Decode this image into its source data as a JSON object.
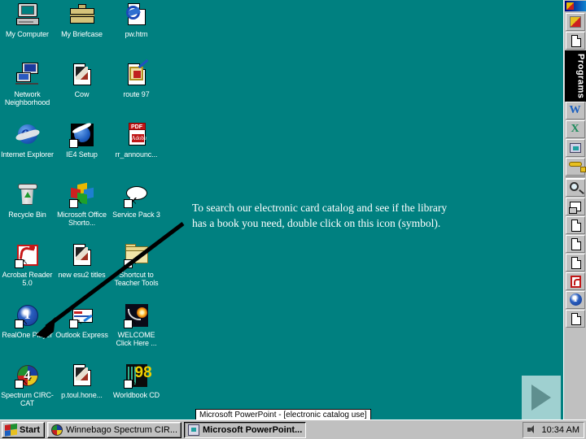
{
  "desktop": {
    "background_color": "#008080",
    "icons": [
      {
        "label": "My Computer",
        "icon": "my-computer-icon",
        "shortcut": false
      },
      {
        "label": "My Briefcase",
        "icon": "briefcase-icon",
        "shortcut": false
      },
      {
        "label": "pw.htm",
        "icon": "html-document-icon",
        "shortcut": false
      },
      {
        "label": "Network Neighborhood",
        "icon": "network-neighborhood-icon",
        "shortcut": false
      },
      {
        "label": "Cow",
        "icon": "image-document-icon",
        "shortcut": false
      },
      {
        "label": "route 97",
        "icon": "route-document-icon",
        "shortcut": false
      },
      {
        "label": "Internet Explorer",
        "icon": "internet-explorer-icon",
        "shortcut": false
      },
      {
        "label": "IE4 Setup",
        "icon": "ie4-setup-icon",
        "shortcut": true
      },
      {
        "label": "rr_announc...",
        "icon": "adobe-pdf-icon",
        "shortcut": false
      },
      {
        "label": "Recycle Bin",
        "icon": "recycle-bin-icon",
        "shortcut": false
      },
      {
        "label": "Microsoft Office Shorto...",
        "icon": "microsoft-office-icon",
        "shortcut": true
      },
      {
        "label": "Service Pack 3",
        "icon": "service-pack-icon",
        "shortcut": true
      },
      {
        "label": "Acrobat Reader 5.0",
        "icon": "acrobat-reader-icon",
        "shortcut": true
      },
      {
        "label": "new esu2 titles",
        "icon": "image-document-icon",
        "shortcut": false
      },
      {
        "label": "Shortcut to Teacher Tools",
        "icon": "folder-icon",
        "shortcut": true
      },
      {
        "label": "RealOne Player",
        "icon": "realone-player-icon",
        "shortcut": true
      },
      {
        "label": "Outlook Express",
        "icon": "outlook-express-icon",
        "shortcut": true
      },
      {
        "label": "WELCOME Click Here ...",
        "icon": "welcome-icon",
        "shortcut": true
      },
      {
        "label": "Spectrum CIRC-CAT",
        "icon": "spectrum-circ-cat-icon",
        "shortcut": true
      },
      {
        "label": "p.toul.hone...",
        "icon": "image-document-icon",
        "shortcut": false
      },
      {
        "label": "Worldbook CD",
        "icon": "worldbook-cd-icon",
        "shortcut": true
      }
    ]
  },
  "instruction": {
    "text": "To search our electronic card catalog and see if the library has a book you need, double click on this icon (symbol)."
  },
  "annotation": {
    "arrow_color": "#000000",
    "arrow_from": "225,275",
    "arrow_to": "48,409",
    "points_at": "Spectrum CIRC-CAT"
  },
  "office_bar": {
    "group_label": "Programs",
    "buttons": [
      {
        "name": "office-shortcut-bar-icon",
        "glyph": "office-logo"
      },
      {
        "name": "new-document-icon",
        "glyph": "document"
      },
      {
        "name": "word-icon",
        "glyph": "W"
      },
      {
        "name": "excel-icon",
        "glyph": "X"
      },
      {
        "name": "powerpoint-icon",
        "glyph": "ppt"
      },
      {
        "name": "access-key-icon",
        "glyph": "key"
      },
      {
        "name": "find-icon",
        "glyph": "magnifier"
      },
      {
        "name": "notes-icon",
        "glyph": "note"
      },
      {
        "name": "document-1-icon",
        "glyph": "document"
      },
      {
        "name": "document-2-icon",
        "glyph": "document"
      },
      {
        "name": "document-3-icon",
        "glyph": "document"
      },
      {
        "name": "acrobat-icon",
        "glyph": "pdf"
      },
      {
        "name": "realone-icon",
        "glyph": "real"
      },
      {
        "name": "document-4-icon",
        "glyph": "document"
      }
    ]
  },
  "next_button": {
    "label": "",
    "icon": "play-triangle-icon",
    "color": "#9fd0d0"
  },
  "ppt_caption": {
    "text": "Microsoft PowerPoint - [electronic catalog use]"
  },
  "taskbar": {
    "start_label": "Start",
    "tasks": [
      {
        "label": "Winnebago Spectrum CIR...",
        "icon": "spectrum-taskbar-icon",
        "active": false
      },
      {
        "label": "Microsoft PowerPoint...",
        "icon": "powerpoint-taskbar-icon",
        "active": true
      }
    ],
    "tray": {
      "clock": "10:34 AM",
      "volume_icon": "speaker-icon"
    }
  }
}
